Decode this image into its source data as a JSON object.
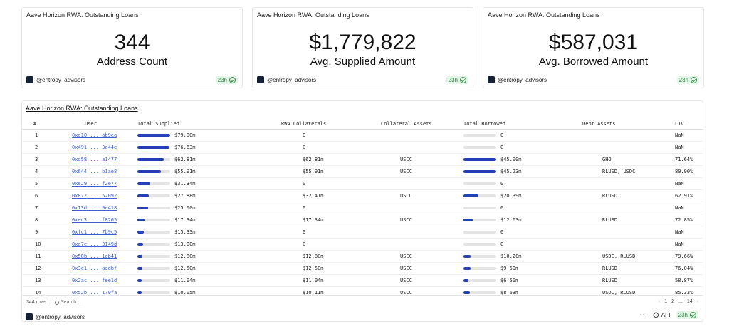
{
  "kpis": [
    {
      "title": "Aave Horizon RWA: Outstanding Loans",
      "value": "344",
      "label": "Address Count",
      "brand": "@entropy_advisors",
      "freshness": "23h"
    },
    {
      "title": "Aave Horizon RWA: Outstanding Loans",
      "value": "$1,779,822",
      "label": "Avg. Supplied Amount",
      "brand": "@entropy_advisors",
      "freshness": "23h"
    },
    {
      "title": "Aave Horizon RWA: Outstanding Loans",
      "value": "$587,031",
      "label": "Avg. Borrowed Amount",
      "brand": "@entropy_advisors",
      "freshness": "23h"
    }
  ],
  "table": {
    "title": "Aave Horizon RWA: Outstanding Loans",
    "columns": [
      "#",
      "User",
      "Total Supplied",
      "RWA Collaterals",
      "Collateral Assets",
      "Total Borrowed",
      "Debt Assets",
      "LTV"
    ],
    "rows": [
      {
        "n": "1",
        "user": "0xe10 ... ab9ea",
        "supplied": "$79.00m",
        "supplied_frac": 1.0,
        "rwa": "0",
        "collateral": "",
        "borrowed": "0",
        "borrowed_frac": 0,
        "debt": "",
        "ltv": "NaN"
      },
      {
        "n": "2",
        "user": "0x491 ... 3a44e",
        "supplied": "$76.63m",
        "supplied_frac": 0.97,
        "rwa": "0",
        "collateral": "",
        "borrowed": "0",
        "borrowed_frac": 0,
        "debt": "",
        "ltv": "NaN"
      },
      {
        "n": "3",
        "user": "0xd58 ... a1477",
        "supplied": "$62.81m",
        "supplied_frac": 0.795,
        "rwa": "$62.81m",
        "collateral": "USCC",
        "borrowed": "$45.00m",
        "borrowed_frac": 0.995,
        "debt": "GHO",
        "ltv": "71.64%"
      },
      {
        "n": "4",
        "user": "0x644 ... b1ae8",
        "supplied": "$55.91m",
        "supplied_frac": 0.708,
        "rwa": "$55.91m",
        "collateral": "USCC",
        "borrowed": "$45.23m",
        "borrowed_frac": 1.0,
        "debt": "RLUSD, USDC",
        "ltv": "80.90%"
      },
      {
        "n": "5",
        "user": "0xe29 ... f2e77",
        "supplied": "$31.34m",
        "supplied_frac": 0.397,
        "rwa": "0",
        "collateral": "",
        "borrowed": "0",
        "borrowed_frac": 0,
        "debt": "",
        "ltv": "NaN"
      },
      {
        "n": "6",
        "user": "0x872 ... 52092",
        "supplied": "$27.88m",
        "supplied_frac": 0.353,
        "rwa": "$32.41m",
        "collateral": "USCC",
        "borrowed": "$20.39m",
        "borrowed_frac": 0.451,
        "debt": "RLUSD",
        "ltv": "62.91%"
      },
      {
        "n": "7",
        "user": "0x13d ... 9e418",
        "supplied": "$25.00m",
        "supplied_frac": 0.316,
        "rwa": "0",
        "collateral": "",
        "borrowed": "0",
        "borrowed_frac": 0,
        "debt": "",
        "ltv": "NaN"
      },
      {
        "n": "8",
        "user": "0xec3 ... f8265",
        "supplied": "$17.34m",
        "supplied_frac": 0.219,
        "rwa": "$17.34m",
        "collateral": "USCC",
        "borrowed": "$12.63m",
        "borrowed_frac": 0.279,
        "debt": "RLUSD",
        "ltv": "72.85%"
      },
      {
        "n": "9",
        "user": "0xfc1 ... 7b9c5",
        "supplied": "$15.33m",
        "supplied_frac": 0.194,
        "rwa": "0",
        "collateral": "",
        "borrowed": "0",
        "borrowed_frac": 0,
        "debt": "",
        "ltv": "NaN"
      },
      {
        "n": "10",
        "user": "0xe7c ... 3149d",
        "supplied": "$13.00m",
        "supplied_frac": 0.165,
        "rwa": "0",
        "collateral": "",
        "borrowed": "0",
        "borrowed_frac": 0,
        "debt": "",
        "ltv": "NaN"
      },
      {
        "n": "11",
        "user": "0x50b ... 1ab41",
        "supplied": "$12.80m",
        "supplied_frac": 0.162,
        "rwa": "$12.80m",
        "collateral": "USCC",
        "borrowed": "$10.20m",
        "borrowed_frac": 0.226,
        "debt": "USDC, RLUSD",
        "ltv": "79.66%"
      },
      {
        "n": "12",
        "user": "0x3c1 ... aedbf",
        "supplied": "$12.50m",
        "supplied_frac": 0.158,
        "rwa": "$12.50m",
        "collateral": "USCC",
        "borrowed": "$9.50m",
        "borrowed_frac": 0.21,
        "debt": "RLUSD",
        "ltv": "76.04%"
      },
      {
        "n": "13",
        "user": "0x2ac ... fee1d",
        "supplied": "$11.04m",
        "supplied_frac": 0.14,
        "rwa": "$11.04m",
        "collateral": "USCC",
        "borrowed": "$6.50m",
        "borrowed_frac": 0.144,
        "debt": "RLUSD",
        "ltv": "58.87%"
      },
      {
        "n": "14",
        "user": "0x52b ... 179fa",
        "supplied": "$10.05m",
        "supplied_frac": 0.127,
        "rwa": "$10.11m",
        "collateral": "USCC",
        "borrowed": "$8.63m",
        "borrowed_frac": 0.191,
        "debt": "USDC, RLUSD",
        "ltv": "85.33%"
      }
    ],
    "row_count": "344 rows",
    "search_placeholder": "Search...",
    "pages": [
      "1",
      "2",
      "...",
      "14"
    ],
    "brand": "@entropy_advisors",
    "api_label": "API",
    "freshness": "23h",
    "colors": {
      "bar": "#2440b8",
      "track": "#e4e4e4",
      "link": "#3f5fd1",
      "badge_bg": "#e3f5e7",
      "badge_fg": "#2f8a45"
    }
  }
}
